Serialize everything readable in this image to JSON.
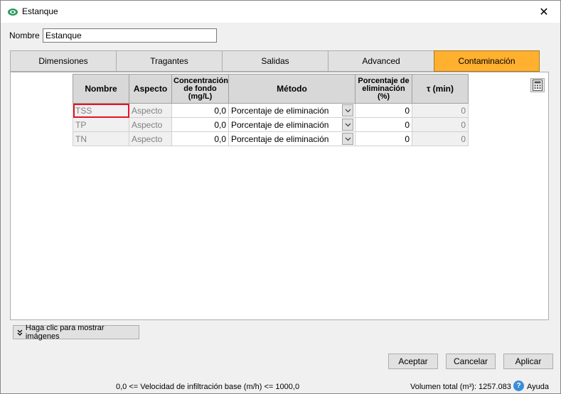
{
  "window": {
    "title": "Estanque",
    "close_glyph": "✕"
  },
  "name_field": {
    "label": "Nombre",
    "value": "Estanque"
  },
  "tabs": [
    {
      "label": "Dimensiones",
      "active": false
    },
    {
      "label": "Tragantes",
      "active": false
    },
    {
      "label": "Salidas",
      "active": false
    },
    {
      "label": "Advanced",
      "active": false
    },
    {
      "label": "Contaminación",
      "active": true
    }
  ],
  "table": {
    "headers": {
      "name": "Nombre",
      "aspect": "Aspecto",
      "background_conc": "Concentración de fondo (mg/L)",
      "method": "Método",
      "removal_pct": "Porcentaje de eliminación (%)",
      "tau": "τ (min)"
    },
    "rows": [
      {
        "name": "TSS",
        "aspect": "Aspecto",
        "background_conc": "0,0",
        "method": "Porcentaje de eliminación",
        "removal_pct": "0",
        "tau": "0"
      },
      {
        "name": "TP",
        "aspect": "Aspecto",
        "background_conc": "0,0",
        "method": "Porcentaje de eliminación",
        "removal_pct": "0",
        "tau": "0"
      },
      {
        "name": "TN",
        "aspect": "Aspecto",
        "background_conc": "0,0",
        "method": "Porcentaje de eliminación",
        "removal_pct": "0",
        "tau": "0"
      }
    ]
  },
  "show_images_button": "Haga clic para mostrar imágenes",
  "buttons": {
    "accept": "Aceptar",
    "cancel": "Cancelar",
    "apply": "Aplicar"
  },
  "footer": {
    "infiltration_text": "0,0 <= Velocidad de infiltración base (m/h) <= 1000,0",
    "volume_text": "Volumen total (m³):  1257.083",
    "help_label": "Ayuda"
  },
  "colors": {
    "active_tab": "#ffb02e",
    "selected_cell_border": "#e81123"
  },
  "icons": [
    "app-logo-icon",
    "close-icon",
    "calculator-icon",
    "chevron-down-icon",
    "double-chevron-down-icon",
    "help-icon"
  ]
}
